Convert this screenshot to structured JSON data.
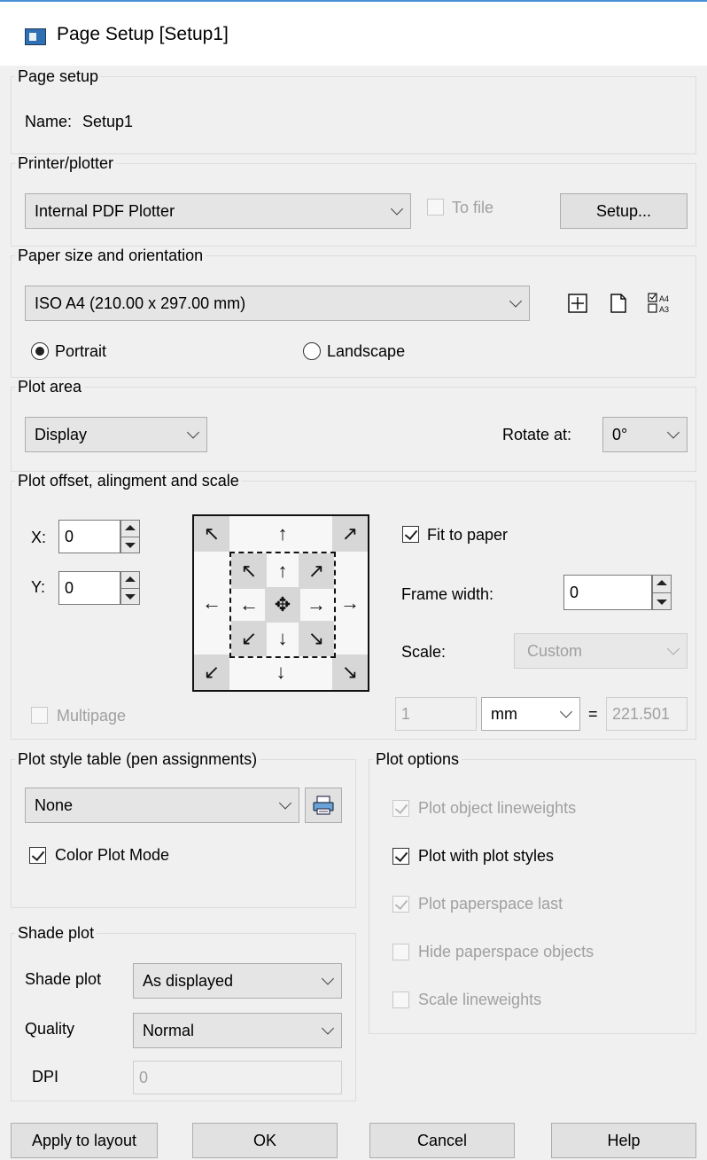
{
  "window": {
    "title": "Page Setup [Setup1]"
  },
  "page_setup": {
    "legend": "Page setup",
    "name_label": "Name:",
    "name_value": "Setup1"
  },
  "printer": {
    "legend": "Printer/plotter",
    "device": "Internal PDF Plotter",
    "to_file_label": "To file",
    "to_file_checked": false,
    "setup_button": "Setup..."
  },
  "paper": {
    "legend": "Paper size and orientation",
    "size": "ISO A4 (210.00 x 297.00 mm)",
    "icons": [
      "plot-extents-icon",
      "paper-icon",
      "paper-size-list-icon"
    ],
    "portrait_label": "Portrait",
    "landscape_label": "Landscape",
    "orientation": "Portrait"
  },
  "plot_area": {
    "legend": "Plot area",
    "area": "Display",
    "rotate_label": "Rotate at:",
    "rotate_value": "0°"
  },
  "offset": {
    "legend": "Plot offset, alingment and scale",
    "x_label": "X:",
    "x_value": "0",
    "y_label": "Y:",
    "y_value": "0",
    "fit_label": "Fit to paper",
    "fit_checked": true,
    "frame_label": "Frame width:",
    "frame_value": "0",
    "scale_label": "Scale:",
    "scale_value": "Custom",
    "scale_left": "1",
    "scale_unit": "mm",
    "equals": "=",
    "scale_right": "221.501",
    "multipage_label": "Multipage",
    "multipage_checked": false
  },
  "pen": {
    "legend": "Plot style table (pen assignments)",
    "table": "None",
    "color_mode_label": "Color Plot Mode",
    "color_mode_checked": true
  },
  "shade": {
    "legend": "Shade plot",
    "shade_label": "Shade plot",
    "shade_value": "As displayed",
    "quality_label": "Quality",
    "quality_value": "Normal",
    "dpi_label": "DPI",
    "dpi_value": "0"
  },
  "options": {
    "legend": "Plot options",
    "lineweights": "Plot object lineweights",
    "with_styles": "Plot with plot styles",
    "paperspace_last": "Plot paperspace last",
    "hide_paperspace": "Hide paperspace objects",
    "scale_lineweights": "Scale lineweights"
  },
  "buttons": {
    "apply": "Apply to layout",
    "ok": "OK",
    "cancel": "Cancel",
    "help": "Help"
  }
}
